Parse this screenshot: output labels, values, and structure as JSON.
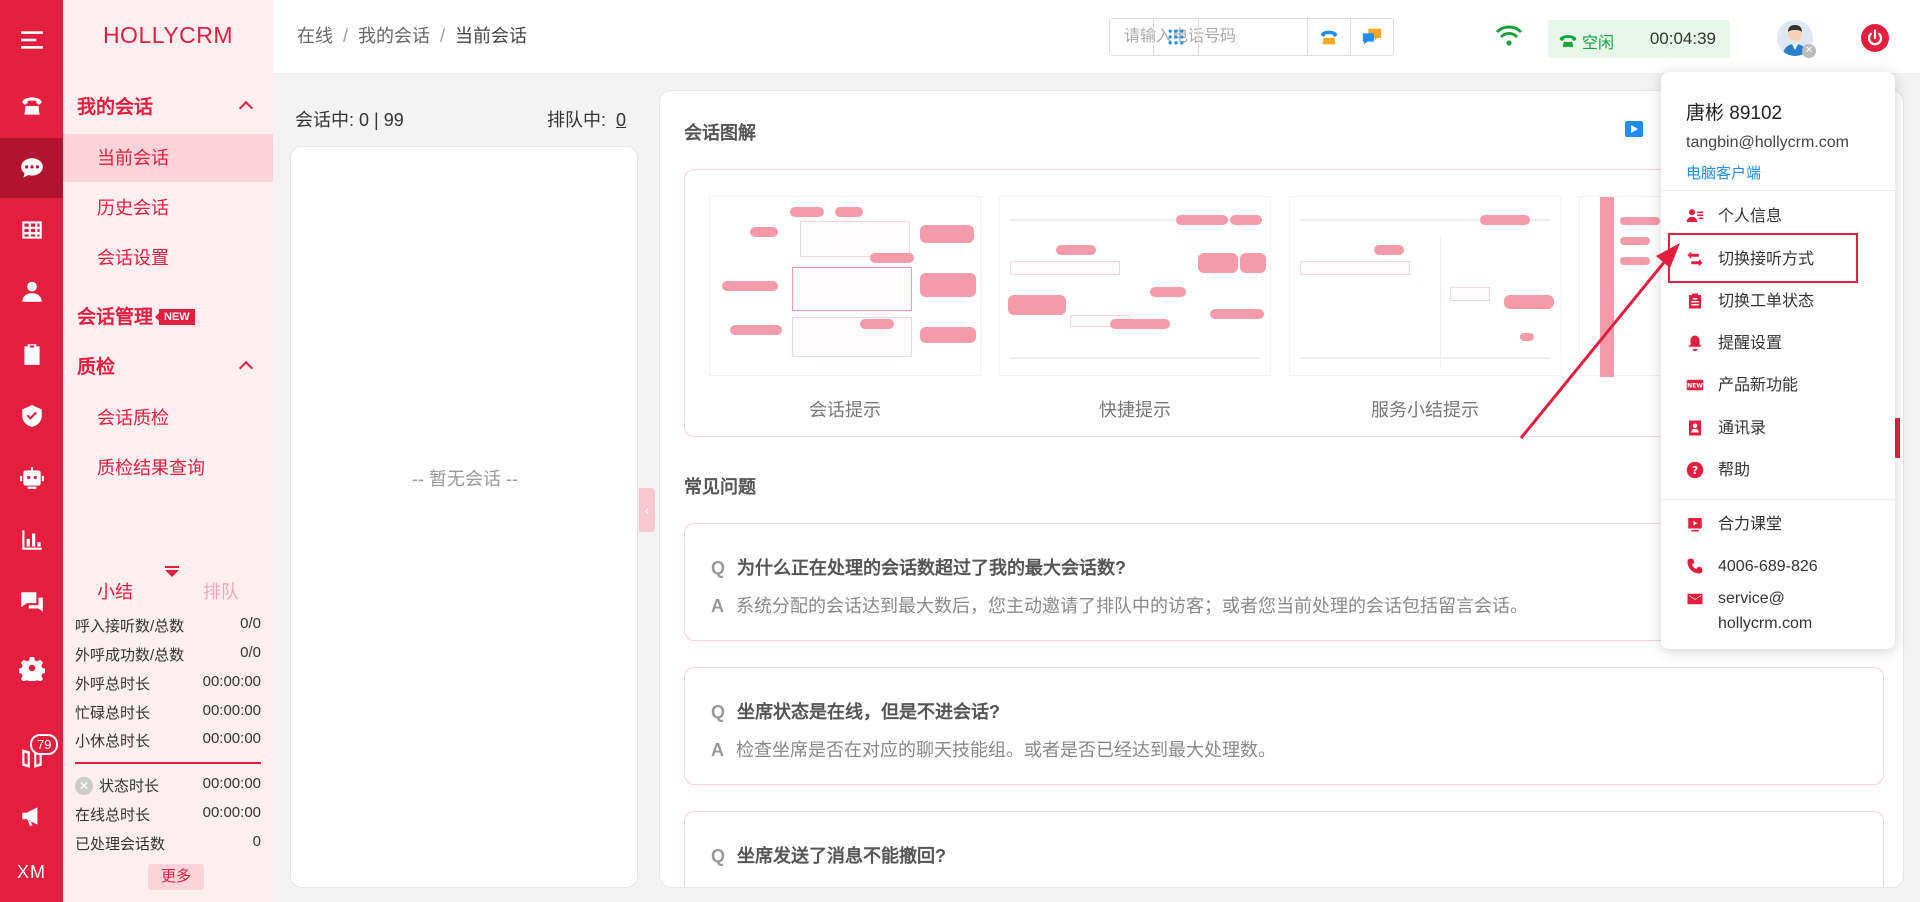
{
  "app": {
    "logo": "HOLLYCRM"
  },
  "rail": {
    "badge_count": "79",
    "xm": "XM"
  },
  "sidebar": {
    "groups": [
      {
        "label": "我的会话",
        "items": [
          "当前会话",
          "历史会话",
          "会话设置"
        ]
      },
      {
        "label": "会话管理",
        "badge": "NEW"
      },
      {
        "label": "质检",
        "items": [
          "会话质检",
          "质检结果查询"
        ]
      }
    ],
    "summary_tabs": [
      "小结",
      "排队"
    ],
    "stats": [
      {
        "label": "呼入接听数/总数",
        "value": "0/0"
      },
      {
        "label": "外呼成功数/总数",
        "value": "0/0"
      },
      {
        "label": "外呼总时长",
        "value": "00:00:00"
      },
      {
        "label": "忙碌总时长",
        "value": "00:00:00"
      },
      {
        "label": "小休总时长",
        "value": "00:00:00"
      },
      {
        "label": "状态时长",
        "value": "00:00:00"
      },
      {
        "label": "在线总时长",
        "value": "00:00:00"
      },
      {
        "label": "已处理会话数",
        "value": "0"
      }
    ],
    "more": "更多"
  },
  "header": {
    "breadcrumb": [
      "在线",
      "我的会话",
      "当前会话"
    ],
    "phone_placeholder": "请输入电话号码",
    "status": "空闲",
    "timer": "00:04:39"
  },
  "sessions": {
    "in_session_label": "会话中:",
    "in_session_value": "0 | 99",
    "queue_label": "排队中:",
    "queue_value": "0",
    "empty": "-- 暂无会话 --"
  },
  "main": {
    "illus_title": "会话图解",
    "cards": [
      "会话提示",
      "快捷提示",
      "服务小结提示"
    ],
    "faq_title": "常见问题",
    "faqs": [
      {
        "q": "为什么正在处理的会话数超过了我的最大会话数?",
        "a": "系统分配的会话达到最大数后，您主动邀请了排队中的访客；或者您当前处理的会话包括留言会话。"
      },
      {
        "q": "坐席状态是在线，但是不进会话?",
        "a": "检查坐席是否在对应的聊天技能组。或者是否已经达到最大处理数。"
      },
      {
        "q": "坐席发送了消息不能撤回?",
        "a": ""
      }
    ]
  },
  "dropdown": {
    "name": "唐彬 89102",
    "email": "tangbin@hollycrm.com",
    "client": "电脑客户端",
    "items": [
      "个人信息",
      "切换接听方式",
      "切换工单状态",
      "提醒设置",
      "产品新功能",
      "通讯录",
      "帮助"
    ],
    "extra": [
      "合力课堂",
      "4006-689-826",
      "service@\nhollycrm.com"
    ]
  },
  "colors": {
    "brand": "#e41e3f",
    "sidebar_bg": "#fdeef0",
    "status_green": "#17a33b",
    "link_blue": "#1f8df4"
  }
}
